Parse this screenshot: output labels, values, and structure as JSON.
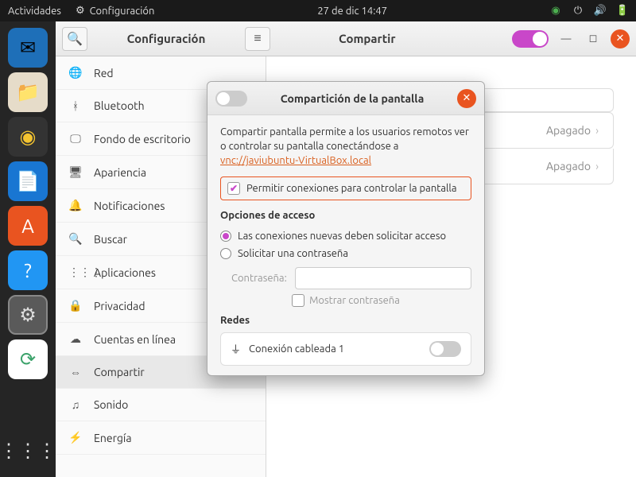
{
  "topbar": {
    "activities": "Actividades",
    "app_name": "Configuración",
    "datetime": "27 de dic  14:47"
  },
  "settings": {
    "title": "Configuración",
    "share_title": "Compartir",
    "share_toggle_on": true,
    "sidebar": [
      {
        "icon": "🌐",
        "label": "Red"
      },
      {
        "icon": "ᚼ",
        "label": "Bluetooth"
      },
      {
        "icon": "🖵",
        "label": "Fondo de escritorio"
      },
      {
        "icon": "🖥",
        "label": "Apariencia"
      },
      {
        "icon": "🔔",
        "label": "Notificaciones"
      },
      {
        "icon": "🔍",
        "label": "Buscar"
      },
      {
        "icon": "⋮⋮⋮",
        "label": "Aplicaciones"
      },
      {
        "icon": "🔒",
        "label": "Privacidad"
      },
      {
        "icon": "☁",
        "label": "Cuentas en línea"
      },
      {
        "icon": "⇔",
        "label": "Compartir",
        "active": true
      },
      {
        "icon": "♫",
        "label": "Sonido"
      },
      {
        "icon": "⚡",
        "label": "Energía"
      }
    ],
    "content": {
      "hostname": "",
      "rows": [
        {
          "label": "",
          "status": "Apagado"
        },
        {
          "label": "",
          "status": "Apagado"
        }
      ]
    }
  },
  "dialog": {
    "title": "Compartición de la pantalla",
    "toggle_on": false,
    "description_pre": "Compartir pantalla permite a los usuarios remotos ver o controlar su pantalla conectándose a ",
    "vnc_url": "vnc://javiubuntu-VirtualBox.local",
    "allow_control": "Permitir conexiones para controlar la pantalla",
    "allow_control_checked": true,
    "access_title": "Opciones de acceso",
    "radio_request": "Las conexiones nuevas deben solicitar acceso",
    "radio_password": "Solicitar una contraseña",
    "radio_selected": "request",
    "password_label": "Contraseña:",
    "password_value": "",
    "show_password": "Mostrar contraseña",
    "networks_title": "Redes",
    "network_name": "Conexión cableada 1",
    "network_on": false
  },
  "colors": {
    "accent": "#e95420",
    "purple": "#c947c9"
  }
}
